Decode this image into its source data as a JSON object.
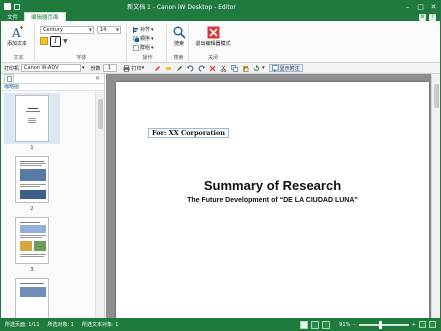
{
  "window": {
    "title": "新文档 1 - Canon iW Desktop - Editor"
  },
  "menu": {
    "tabs": [
      {
        "label": "文件"
      },
      {
        "label": "编辑器页面"
      }
    ]
  },
  "ribbon": {
    "add_text_label": "添加文本",
    "font_name": "Century",
    "font_size": "14",
    "italic_label": "I",
    "group_text": "文本",
    "group_font": "字体",
    "align_label": "对齐",
    "order_label": "顺序",
    "group_label": "群组",
    "group_operation": "操作",
    "search_label": "搜索",
    "group_search": "搜索",
    "close_editor_label": "退出编辑器模式",
    "group_close": "关闭"
  },
  "toolbar": {
    "printer_label": "打印机",
    "printer_value": "Canon iR-ADV",
    "copies_label": "份数",
    "copies_value": "1",
    "print_label": "打印",
    "annotations_label": "显示附注"
  },
  "sidebar": {
    "panel_title": "缩略图",
    "thumbnails": [
      {
        "number": "1"
      },
      {
        "number": "2"
      },
      {
        "number": "3"
      }
    ]
  },
  "document": {
    "text_box": "For: XX Corporation",
    "title": "Summary of Research",
    "subtitle": "The Future Development of “DE LA CIUDAD LUNA”"
  },
  "status": {
    "page_info": "所选页面: 1/11",
    "objects_info": "所选对象: 1",
    "text_info": "所选文本对象: 1",
    "zoom": "91%",
    "zoom_level": 0.41
  },
  "colors": {
    "brand": "#1f7a3e",
    "accent": "#1f5e8d",
    "close_red": "#d9363e"
  }
}
